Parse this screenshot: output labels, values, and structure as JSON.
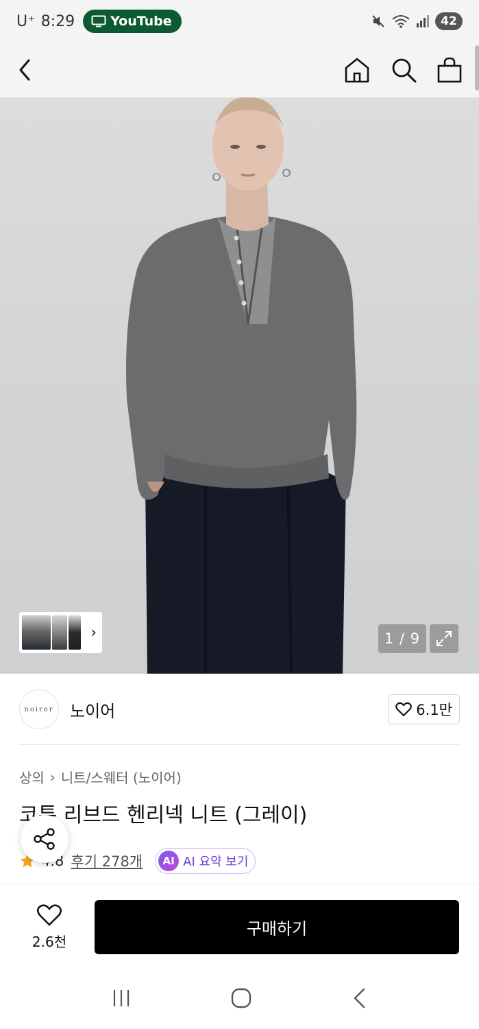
{
  "status_bar": {
    "carrier": "U⁺",
    "time": "8:29",
    "active_app": "YouTube",
    "battery": "42"
  },
  "product": {
    "image_counter": "1 / 9",
    "brand_logo_text": "noirer",
    "brand_name": "노이어",
    "brand_likes": "6.1만",
    "breadcrumb": [
      "상의",
      "니트/스웨터 (노이어)"
    ],
    "title": "코튼 리브드 헨리넥 니트 (그레이)",
    "rating": "4.8",
    "reviews": "후기 278개",
    "ai_badge": "AI",
    "ai_summary": "AI 요약 보기"
  },
  "purchase_bar": {
    "wish_count": "2.6천",
    "buy_label": "구매하기"
  },
  "colors": {
    "youtube_pill": "#0c5a33",
    "rating_star": "#f5a623",
    "ai_accent": "#6b3fd1",
    "buy_button": "#000000"
  }
}
